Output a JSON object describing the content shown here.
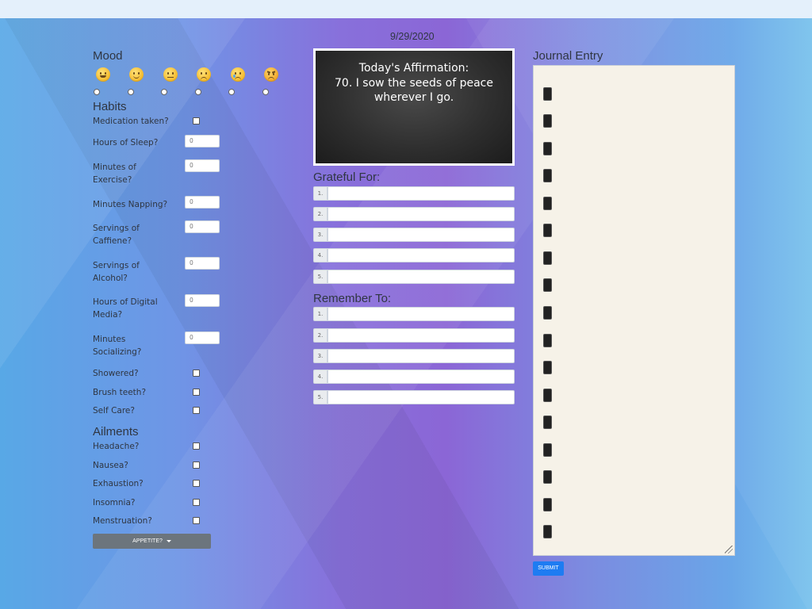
{
  "date": "9/29/2020",
  "mood": {
    "title": "Mood",
    "options": [
      "grinning-face",
      "slightly-smiling-face",
      "neutral-face",
      "slightly-frowning-face",
      "crying-face",
      "angry-face"
    ]
  },
  "habits": {
    "title": "Habits",
    "medication_label": "Medication taken?",
    "sleep_label": "Hours of Sleep?",
    "sleep_value": "0",
    "exercise_label": "Minutes of Exercise?",
    "exercise_value": "0",
    "napping_label": "Minutes Napping?",
    "napping_value": "0",
    "caffeine_label": "Servings of Caffiene?",
    "caffeine_value": "0",
    "alcohol_label": "Servings of Alcohol?",
    "alcohol_value": "0",
    "digital_label": "Hours of Digital Media?",
    "digital_value": "0",
    "socializing_label": "Minutes Socializing?",
    "socializing_value": "0",
    "showered_label": "Showered?",
    "brush_label": "Brush teeth?",
    "selfcare_label": "Self Care?"
  },
  "ailments": {
    "title": "Ailments",
    "headache_label": "Headache?",
    "nausea_label": "Nausea?",
    "exhaustion_label": "Exhaustion?",
    "insomnia_label": "Insomnia?",
    "menstruation_label": "Menstruation?",
    "appetite_button": "APPETITE?"
  },
  "affirmation": {
    "heading": "Today's Affirmation:",
    "text": "70. I sow the seeds of peace wherever I go."
  },
  "grateful": {
    "title": "Grateful For:",
    "indices": [
      "1.",
      "2.",
      "3.",
      "4.",
      "5."
    ]
  },
  "remember": {
    "title": "Remember To:",
    "indices": [
      "1.",
      "2.",
      "3.",
      "4.",
      "5."
    ]
  },
  "journal": {
    "title": "Journal Entry",
    "submit_label": "SUBMIT"
  },
  "colors": {
    "submit": "#1e7cf2",
    "appetite": "#6c757d",
    "journal_bg": "#f6f2e8"
  }
}
